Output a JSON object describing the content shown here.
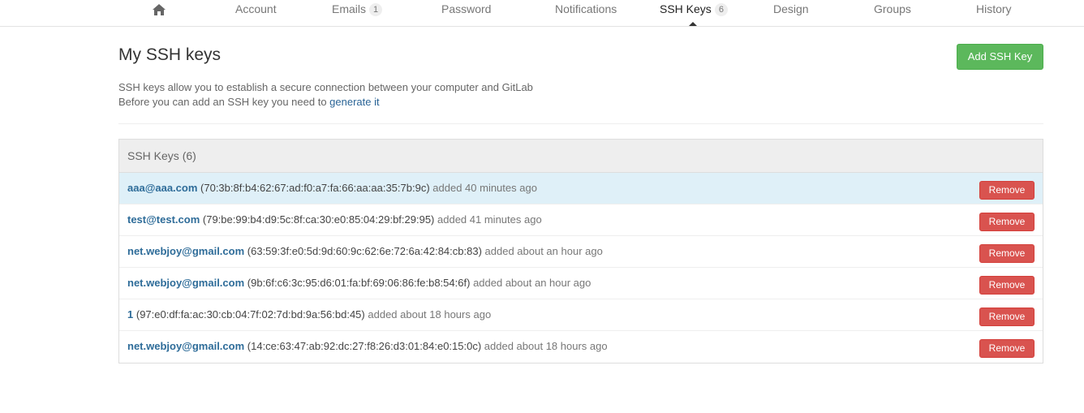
{
  "nav": {
    "home_icon": "home-icon",
    "items": [
      {
        "label": "Account"
      },
      {
        "label": "Emails",
        "badge": "1"
      },
      {
        "label": "Password"
      },
      {
        "label": "Notifications"
      },
      {
        "label": "SSH Keys",
        "badge": "6",
        "active": true
      },
      {
        "label": "Design"
      },
      {
        "label": "Groups"
      },
      {
        "label": "History"
      }
    ]
  },
  "page": {
    "title": "My SSH keys",
    "add_button": "Add SSH Key",
    "desc_line1": "SSH keys allow you to establish a secure connection between your computer and GitLab",
    "desc_line2_prefix": "Before you can add an SSH key you need to ",
    "desc_link": "generate it"
  },
  "panel": {
    "heading": "SSH Keys (6)",
    "remove_label": "Remove",
    "keys": [
      {
        "title": "aaa@aaa.com",
        "fingerprint": "(70:3b:8f:b4:62:67:ad:f0:a7:fa:66:aa:aa:35:7b:9c)",
        "added": "added 40 minutes ago"
      },
      {
        "title": "test@test.com",
        "fingerprint": "(79:be:99:b4:d9:5c:8f:ca:30:e0:85:04:29:bf:29:95)",
        "added": "added 41 minutes ago"
      },
      {
        "title": "net.webjoy@gmail.com",
        "fingerprint": "(63:59:3f:e0:5d:9d:60:9c:62:6e:72:6a:42:84:cb:83)",
        "added": "added about an hour ago"
      },
      {
        "title": "net.webjoy@gmail.com",
        "fingerprint": "(9b:6f:c6:3c:95:d6:01:fa:bf:69:06:86:fe:b8:54:6f)",
        "added": "added about an hour ago"
      },
      {
        "title": "1",
        "fingerprint": "(97:e0:df:fa:ac:30:cb:04:7f:02:7d:bd:9a:56:bd:45)",
        "added": "added about 18 hours ago"
      },
      {
        "title": "net.webjoy@gmail.com",
        "fingerprint": "(14:ce:63:47:ab:92:dc:27:f8:26:d3:01:84:e0:15:0c)",
        "added": "added about 18 hours ago"
      }
    ]
  },
  "colors": {
    "add_button": "#5cb85c",
    "remove_button": "#d9534f",
    "highlight_row": "#dff0f8",
    "link": "#2e6c99"
  }
}
